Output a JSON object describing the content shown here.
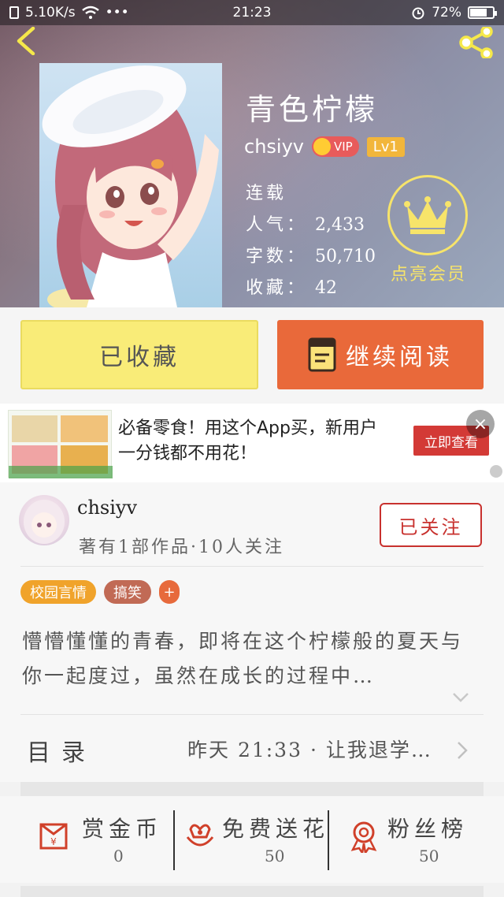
{
  "status_bar": {
    "speed": "5.10K/s",
    "more": "•••",
    "time": "21:23",
    "battery": "72%"
  },
  "book": {
    "title": "青色柠檬",
    "author": "chsiyv",
    "vip": "VIP",
    "level": "Lv1",
    "status": "连载",
    "popularity_label": "人气：",
    "popularity": "2,433",
    "words_label": "字数：",
    "words": "50,710",
    "favorites_label": "收藏：",
    "favorites": "42"
  },
  "member": {
    "label": "点亮会员"
  },
  "actions": {
    "collected_label": "已收藏",
    "read_label": "继续阅读"
  },
  "ad": {
    "text": "必备零食！用这个App买，新用户一分钱都不用花！",
    "cta": "立即查看",
    "close": "×"
  },
  "author_card": {
    "name": "chsiyv",
    "subtitle": "著有1部作品·10人关注",
    "follow_label": "已关注"
  },
  "tags": [
    {
      "label": "校园言情"
    },
    {
      "label": "搞笑"
    },
    {
      "label": "+"
    }
  ],
  "intro": "懵懵懂懂的青春，即将在这个柠檬般的夏天与你一起度过，虽然在成长的过程中…",
  "toc": {
    "title": "目录",
    "latest": "昨天 21:33 · 让我退学…"
  },
  "rewards": [
    {
      "name": "赏金币",
      "count": "0"
    },
    {
      "name": "免费送花",
      "count": "50"
    },
    {
      "name": "粉丝榜",
      "count": "50"
    }
  ],
  "colors": {
    "read_button": "#e9693a",
    "collected_button": "#f9ec78",
    "follow_accent": "#c8312e",
    "member_gold": "#f7e46a"
  }
}
